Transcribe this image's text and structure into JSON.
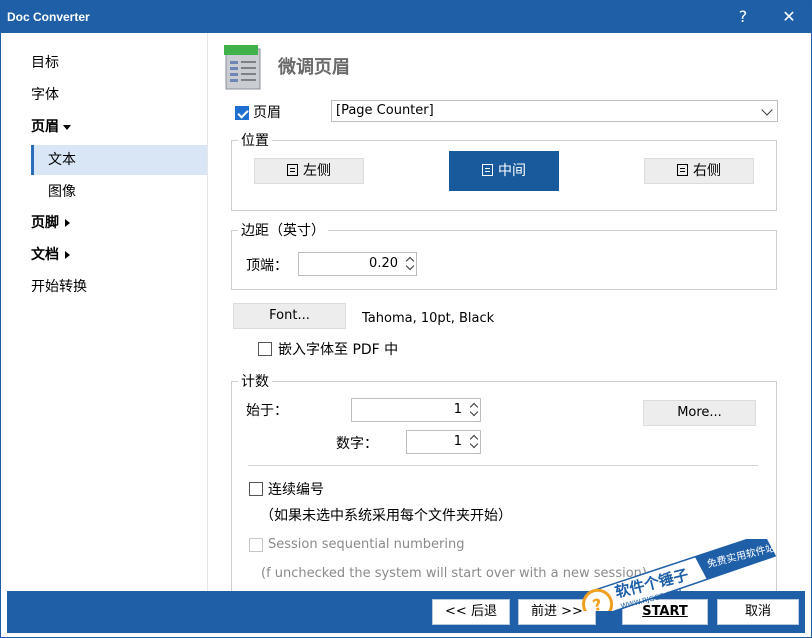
{
  "window": {
    "title": "Doc Converter",
    "help_label": "?",
    "close_label": "✕"
  },
  "sidebar": {
    "items": [
      {
        "label": "目标"
      },
      {
        "label": "字体"
      },
      {
        "label": "页眉"
      },
      {
        "label": "文本"
      },
      {
        "label": "图像"
      },
      {
        "label": "页脚"
      },
      {
        "label": "文档"
      },
      {
        "label": "开始转换"
      }
    ]
  },
  "page": {
    "title": "微调页眉"
  },
  "header_row": {
    "checkbox_label": "页眉",
    "checked": true,
    "select_value": "[Page Counter]"
  },
  "position": {
    "group_label": "位置",
    "buttons": [
      {
        "label": "左侧"
      },
      {
        "label": "中间"
      },
      {
        "label": "右侧"
      }
    ],
    "selected": "中间"
  },
  "margin": {
    "group_label": "边距（英寸）",
    "top_label": "顶端：",
    "top_value": "0.20"
  },
  "font": {
    "button_label": "Font...",
    "description": "Tahoma, 10pt, Black",
    "embed_label": "嵌入字体至 PDF 中",
    "embed_checked": false
  },
  "counter": {
    "group_label": "计数",
    "start_label": "始于：",
    "start_value": "1",
    "digits_label": "数字：",
    "digits_value": "1",
    "more_label": "More...",
    "continuous_label": "连续编号",
    "continuous_note": "（如果未选中系统采用每个文件夹开始）",
    "session_label": "Session sequential numbering",
    "session_note": "(f unchecked the system will start over with a new session)"
  },
  "footer": {
    "back_label": "<< 后退",
    "next_label": "前进 >>",
    "start_label": "START",
    "cancel_label": "取消"
  },
  "watermark": {
    "line1": "软件个锤子",
    "line2": "免费实用软件站",
    "url": "WWW.RJGCZ.COM"
  },
  "colors": {
    "titlebar": "#1f5fa8",
    "accent": "#195a9d",
    "selected_nav": "#d9e6f5"
  }
}
